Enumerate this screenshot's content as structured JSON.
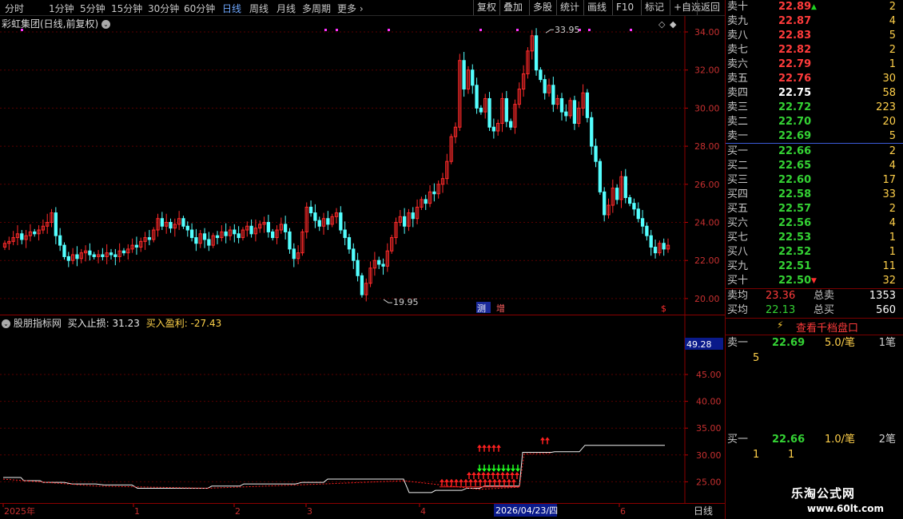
{
  "toolbar": {
    "timeframes": [
      "分时",
      "1分钟",
      "5分钟",
      "15分钟",
      "30分钟",
      "60分钟",
      "日线",
      "周线",
      "月线",
      "多周期",
      "更多"
    ],
    "active": "日线",
    "buttons": [
      "复权",
      "叠加",
      "多股",
      "统计",
      "画线",
      "F10",
      "标记",
      "+自选",
      "返回"
    ]
  },
  "chart": {
    "title": "彩虹集团(日线,前复权)",
    "y_ticks": [
      "34.00",
      "32.00",
      "30.00",
      "28.00",
      "26.00",
      "24.00",
      "22.00",
      "20.00"
    ],
    "high_label": "33.95",
    "low_label": "19.95",
    "markers": [
      "测",
      "增",
      "$"
    ]
  },
  "indicator": {
    "name": "股朋指标网",
    "stop_label": "买入止损: 31.23",
    "profit_label": "买入盈利: -27.43",
    "current_value": "49.28",
    "y_ticks": [
      "45.00",
      "40.00",
      "35.00",
      "30.00",
      "25.00"
    ]
  },
  "xaxis": {
    "labels": [
      "2025年",
      "1",
      "2",
      "3",
      "4",
      "6"
    ],
    "cursor_date": "2026/04/23/四",
    "period": "日线"
  },
  "orderbook": {
    "asks": [
      {
        "label": "卖十",
        "price": "22.89",
        "vol": "2",
        "color": "#ff3b3b",
        "arrow": "up"
      },
      {
        "label": "卖九",
        "price": "22.87",
        "vol": "4",
        "color": "#ff3b3b"
      },
      {
        "label": "卖八",
        "price": "22.83",
        "vol": "5",
        "color": "#ff3b3b"
      },
      {
        "label": "卖七",
        "price": "22.82",
        "vol": "2",
        "color": "#ff3b3b"
      },
      {
        "label": "卖六",
        "price": "22.79",
        "vol": "1",
        "color": "#ff3b3b"
      },
      {
        "label": "卖五",
        "price": "22.76",
        "vol": "30",
        "color": "#ff3b3b"
      },
      {
        "label": "卖四",
        "price": "22.75",
        "vol": "58",
        "color": "#ffffff"
      },
      {
        "label": "卖三",
        "price": "22.72",
        "vol": "223",
        "color": "#34d234"
      },
      {
        "label": "卖二",
        "price": "22.70",
        "vol": "20",
        "color": "#34d234"
      },
      {
        "label": "卖一",
        "price": "22.69",
        "vol": "5",
        "color": "#34d234"
      }
    ],
    "bids": [
      {
        "label": "买一",
        "price": "22.66",
        "vol": "2",
        "color": "#34d234"
      },
      {
        "label": "买二",
        "price": "22.65",
        "vol": "4",
        "color": "#34d234"
      },
      {
        "label": "买三",
        "price": "22.60",
        "vol": "17",
        "color": "#34d234"
      },
      {
        "label": "买四",
        "price": "22.58",
        "vol": "33",
        "color": "#34d234"
      },
      {
        "label": "买五",
        "price": "22.57",
        "vol": "2",
        "color": "#34d234"
      },
      {
        "label": "买六",
        "price": "22.56",
        "vol": "4",
        "color": "#34d234"
      },
      {
        "label": "买七",
        "price": "22.53",
        "vol": "1",
        "color": "#34d234"
      },
      {
        "label": "买八",
        "price": "22.52",
        "vol": "1",
        "color": "#34d234"
      },
      {
        "label": "买九",
        "price": "22.51",
        "vol": "11",
        "color": "#34d234"
      },
      {
        "label": "买十",
        "price": "22.50",
        "vol": "32",
        "color": "#34d234",
        "arrow": "down"
      }
    ],
    "avg_ask": {
      "label": "卖均",
      "price": "23.36",
      "tot_label": "总卖",
      "tot": "1353"
    },
    "avg_bid": {
      "label": "买均",
      "price": "22.13",
      "tot_label": "总买",
      "tot": "560"
    },
    "depth_button": "查看千档盘口",
    "ask1": {
      "label": "卖一",
      "price": "22.69",
      "per": "5.0/笔",
      "cnt": "1笔",
      "detail": "5"
    },
    "bid1": {
      "label": "买一",
      "price": "22.66",
      "per": "1.0/笔",
      "cnt": "2笔",
      "detail": [
        "1",
        "1"
      ]
    }
  },
  "watermark": {
    "name": "乐淘公式网",
    "url": "www.60lt.com"
  }
}
